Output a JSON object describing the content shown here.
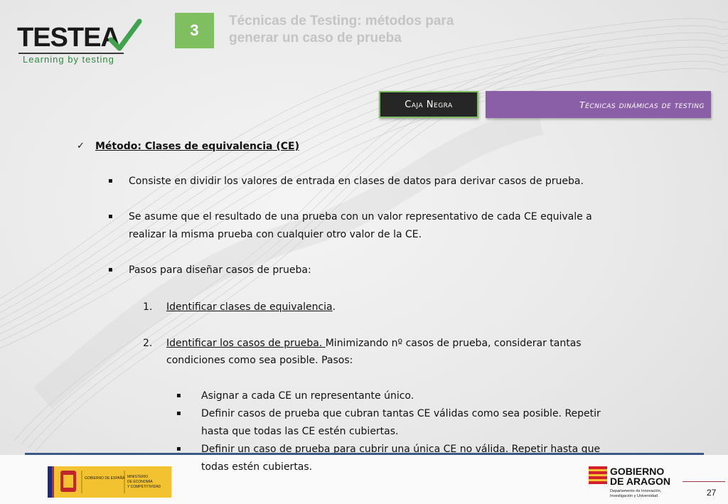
{
  "logo": {
    "name": "TESTEA",
    "tagline": "Learning by testing"
  },
  "header": {
    "unit_number": "3",
    "unit_title_line1": "Técnicas de Testing: métodos para",
    "unit_title_line2": "generar un caso de prueba"
  },
  "tags": {
    "black_box": "Caja Negra",
    "dynamic": "Técnicas dinámicas de testing"
  },
  "content": {
    "heading": "Método: Clases de equivalencia (CE)",
    "bullet1": "Consiste en dividir los valores de entrada en clases de datos para derivar casos de prueba.",
    "bullet2_line1": "Se asume que el resultado de una prueba con un valor representativo de cada CE equivale a",
    "bullet2_line2": "realizar la misma prueba con cualquier otro valor de la CE.",
    "bullet3": "Pasos para diseñar casos de prueba:",
    "step1_num": "1.",
    "step1_link": "Identificar clases de equivalencia",
    "step1_tail": ".",
    "step2_num": "2.",
    "step2_link": "Identificar los casos de prueba. ",
    "step2_tail": "Minimizando nº casos de prueba, considerar tantas",
    "step2_line2": "condiciones como sea posible. Pasos:",
    "sub1": "Asignar a cada CE un representante único.",
    "sub2_line1": "Definir casos de prueba que cubran tantas CE válidas como sea posible. Repetir",
    "sub2_line2": "hasta que todas las CE estén cubiertas.",
    "sub3_line1": "Definir un caso de prueba para cubrir una única CE no válida. Repetir hasta que",
    "sub3_line2": "todas estén cubiertas."
  },
  "footer": {
    "spain_gov": "GOBIERNO DE ESPAÑA",
    "spain_ministry_line1": "MINISTERIO",
    "spain_ministry_line2": "DE ECONOMÍA",
    "spain_ministry_line3": "Y COMPETITIVIDAD",
    "aragon_line1": "GOBIERNO",
    "aragon_line2": "DE ARAGON",
    "aragon_dept_line1": "Departamento de Innovación,",
    "aragon_dept_line2": "Investigación y Universidad",
    "page_number": "27"
  },
  "colors": {
    "accent_green": "#7fbf5f",
    "purple": "#8a5fa7",
    "footer_blue": "#3a5a85"
  }
}
